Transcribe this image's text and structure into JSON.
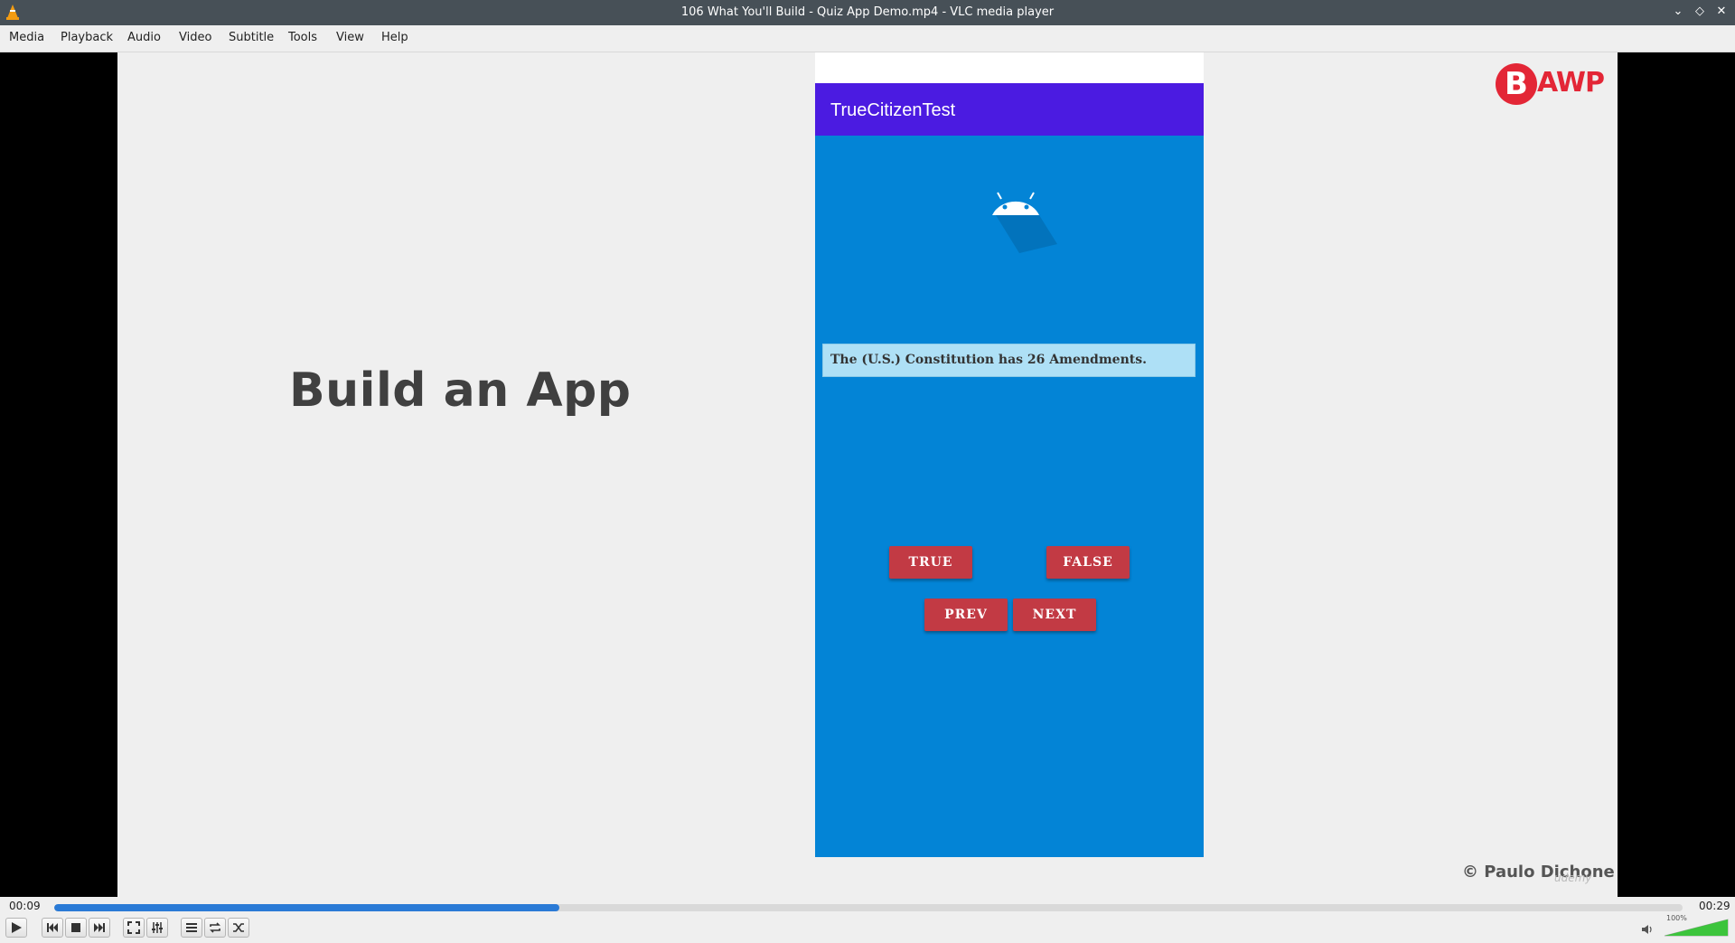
{
  "window": {
    "title": "106 What You'll Build - Quiz App Demo.mp4 - VLC media player"
  },
  "menu": [
    "Media",
    "Playback",
    "Audio",
    "Video",
    "Subtitle",
    "Tools",
    "View",
    "Help"
  ],
  "slide": {
    "heading": "Build an App",
    "logo_letter": "B",
    "logo_text": "AWP",
    "copyright": "© Paulo Dichone",
    "watermark": "udemy"
  },
  "phone": {
    "app_title": "TrueCitizenTest",
    "question": "The (U.S.) Constitution has 26 Amendments.",
    "buttons": {
      "true": "TRUE",
      "false": "FALSE",
      "prev": "PREV",
      "next": "NEXT"
    }
  },
  "player": {
    "elapsed": "00:09",
    "total": "00:29",
    "progress_fraction": 0.31,
    "volume_label": "100%",
    "volume_fraction": 1.0,
    "colors": {
      "seek_fill": "#2a7ad6",
      "app_bar": "#4b1be1",
      "phone_bg": "#0384d6",
      "button": "#c23a44"
    }
  }
}
